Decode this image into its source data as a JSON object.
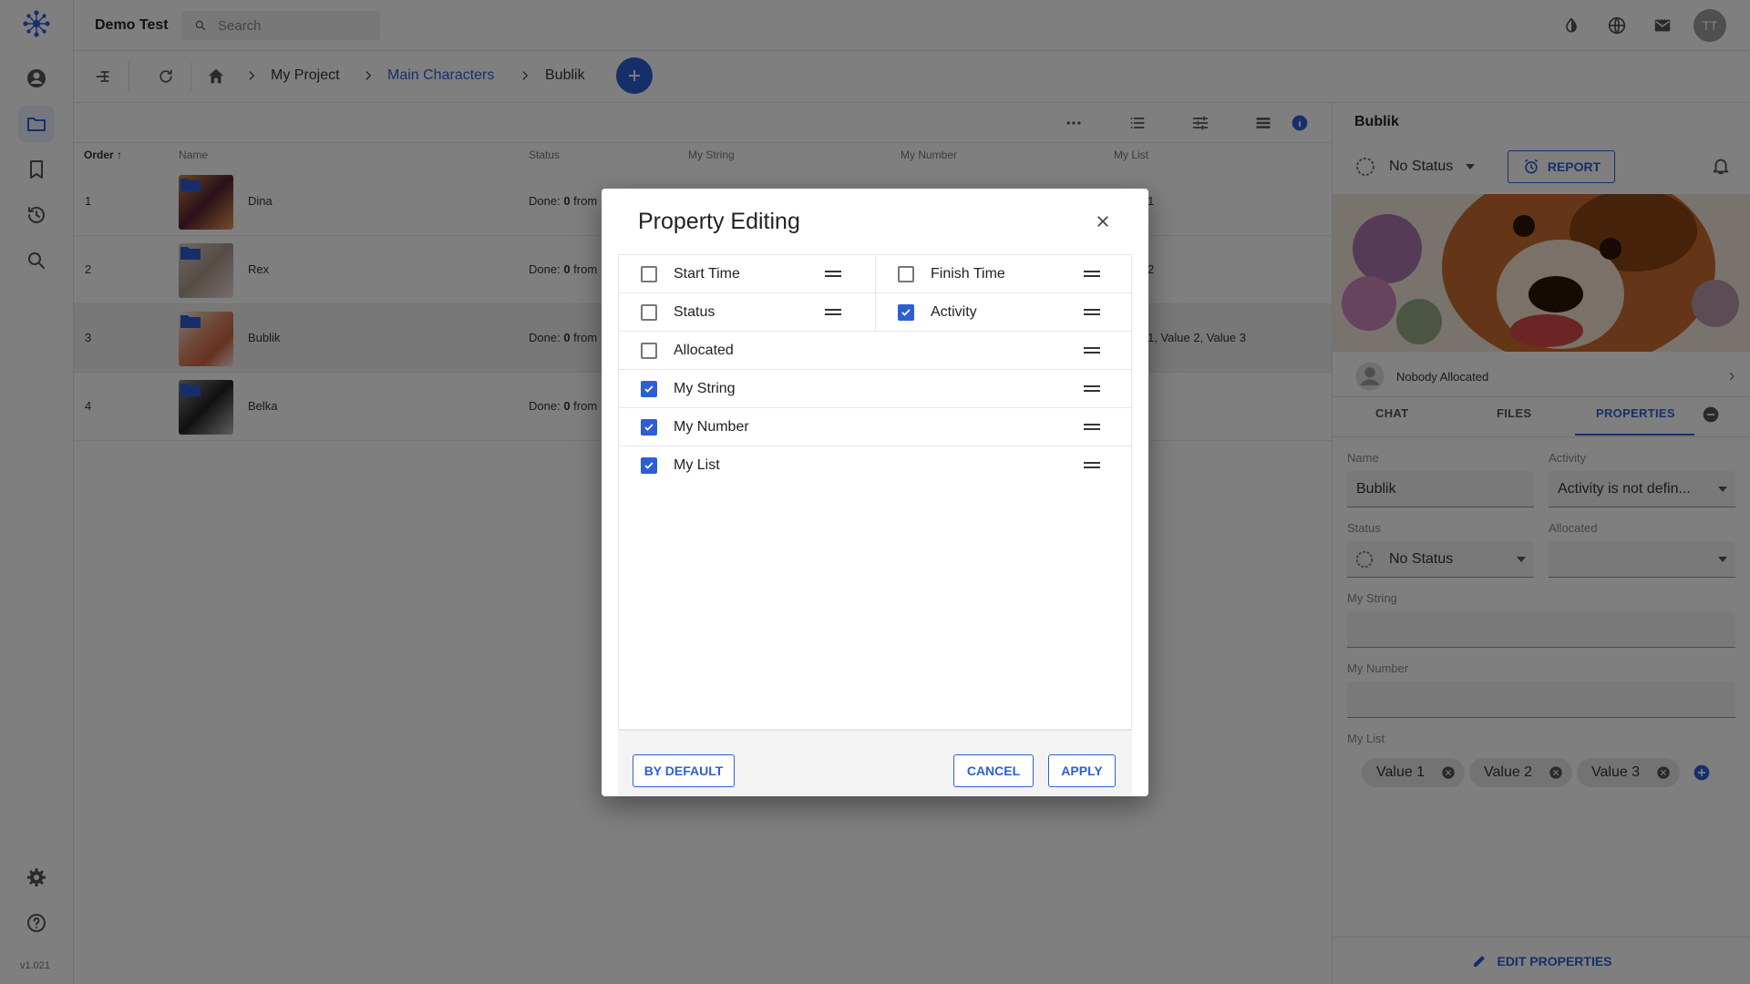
{
  "app": {
    "title": "Demo Test",
    "version": "v1.021"
  },
  "search": {
    "placeholder": "Search"
  },
  "user": {
    "initials": "TT"
  },
  "breadcrumb": {
    "items": [
      "My Project",
      "Main Characters",
      "Bublik"
    ]
  },
  "table": {
    "headers": {
      "order": "Order",
      "name": "Name",
      "status": "Status",
      "my_string": "My String",
      "my_number": "My Number",
      "my_list": "My List"
    },
    "rows": [
      {
        "order": "1",
        "name": "Dina",
        "status_prefix": "Done: ",
        "status_bold": "0",
        "status_suffix": " from",
        "my_list": "1"
      },
      {
        "order": "2",
        "name": "Rex",
        "status_prefix": "Done: ",
        "status_bold": "0",
        "status_suffix": " from",
        "my_list": "2"
      },
      {
        "order": "3",
        "name": "Bublik",
        "status_prefix": "Done: ",
        "status_bold": "0",
        "status_suffix": " from",
        "my_list": "1, Value 2, Value 3"
      },
      {
        "order": "4",
        "name": "Belka",
        "status_prefix": "Done: ",
        "status_bold": "0",
        "status_suffix": " from",
        "my_list": ""
      }
    ]
  },
  "panel": {
    "title": "Bublik",
    "status": "No Status",
    "report_label": "REPORT",
    "allocated": "Nobody Allocated",
    "tabs": [
      "CHAT",
      "FILES",
      "PROPERTIES"
    ],
    "fields": {
      "name_label": "Name",
      "name_value": "Bublik",
      "activity_label": "Activity",
      "activity_value": "Activity is not defin...",
      "status_label": "Status",
      "status_value": "No Status",
      "allocated_label": "Allocated",
      "allocated_value": "",
      "my_string_label": "My String",
      "my_number_label": "My Number",
      "my_list_label": "My List"
    },
    "list_chips": [
      "Value 1",
      "Value 2",
      "Value 3"
    ],
    "edit_label": "EDIT PROPERTIES"
  },
  "dialog": {
    "title": "Property Editing",
    "properties": [
      {
        "label": "Start Time",
        "checked": false
      },
      {
        "label": "Finish Time",
        "checked": false
      },
      {
        "label": "Status",
        "checked": false
      },
      {
        "label": "Activity",
        "checked": true
      },
      {
        "label": "Allocated",
        "checked": false
      },
      {
        "label": "My String",
        "checked": true
      },
      {
        "label": "My Number",
        "checked": true
      },
      {
        "label": "My List",
        "checked": true
      }
    ],
    "by_default_label": "BY DEFAULT",
    "cancel_label": "CANCEL",
    "apply_label": "APPLY"
  },
  "colors": {
    "accent": "#2c5fd6",
    "overlay": "rgba(0,0,0,0.5)"
  }
}
